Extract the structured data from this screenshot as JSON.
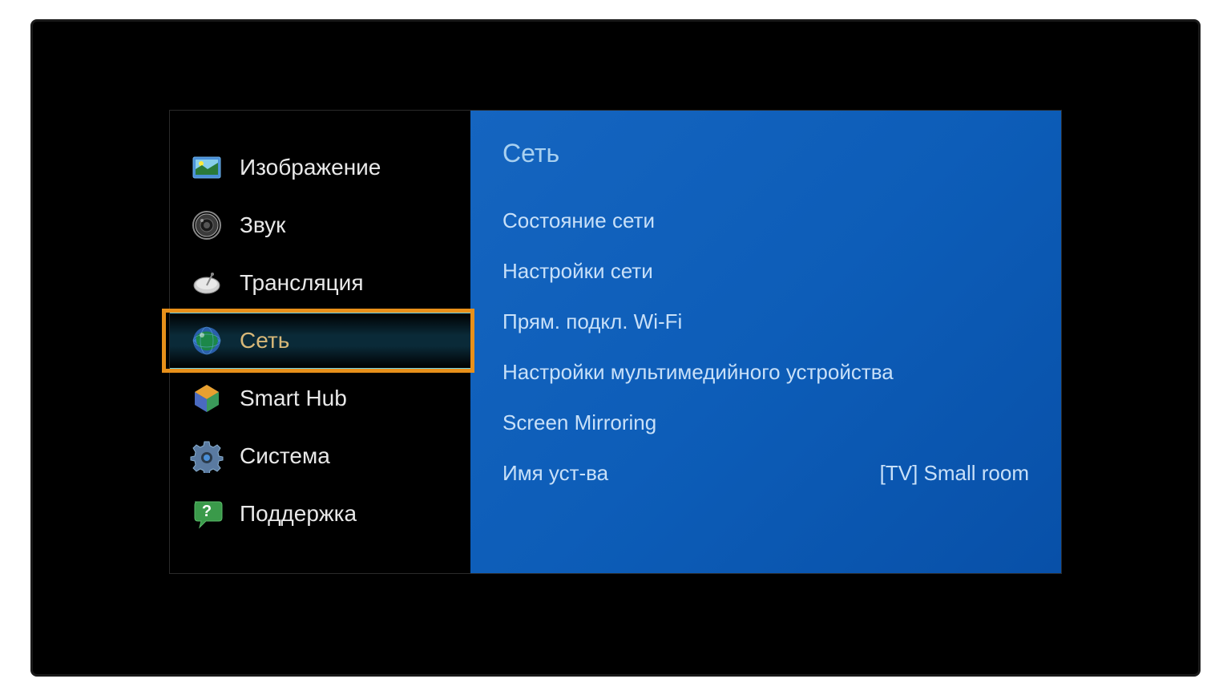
{
  "sidebar": {
    "items": [
      {
        "label": "Изображение",
        "icon": "picture-icon"
      },
      {
        "label": "Звук",
        "icon": "sound-icon"
      },
      {
        "label": "Трансляция",
        "icon": "broadcast-icon"
      },
      {
        "label": "Сеть",
        "icon": "network-icon"
      },
      {
        "label": "Smart Hub",
        "icon": "smarthub-icon"
      },
      {
        "label": "Система",
        "icon": "system-icon"
      },
      {
        "label": "Поддержка",
        "icon": "support-icon"
      }
    ]
  },
  "panel": {
    "title": "Сеть",
    "items": [
      {
        "label": "Состояние сети",
        "value": ""
      },
      {
        "label": "Настройки сети",
        "value": ""
      },
      {
        "label": "Прям. подкл. Wi-Fi",
        "value": ""
      },
      {
        "label": "Настройки мультимедийного устройства",
        "value": ""
      },
      {
        "label": "Screen Mirroring",
        "value": ""
      },
      {
        "label": "Имя уст-ва",
        "value": "[TV] Small room"
      }
    ]
  }
}
